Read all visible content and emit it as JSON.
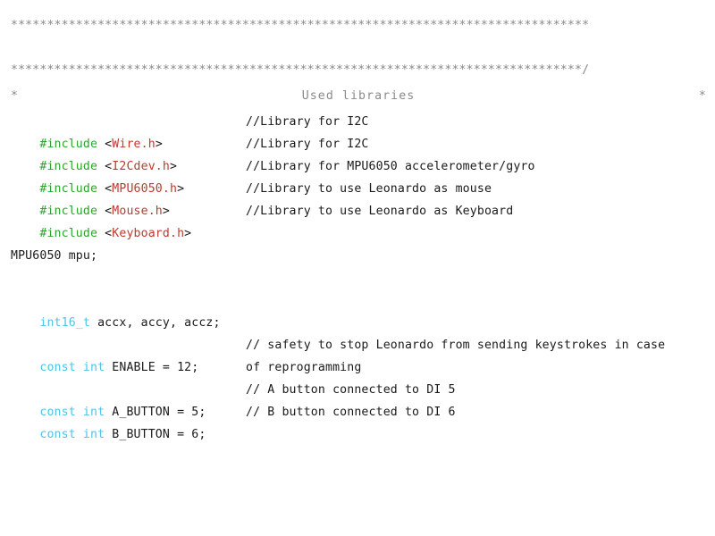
{
  "document": {
    "language": "arduino-c",
    "background_color": "#ffffff",
    "colors": {
      "preprocessor": "#2ea32e",
      "header_name": "#c0392b",
      "keyword": "#4fc3e8",
      "plain": "#1a1a1a",
      "comment": "#1a1a1a",
      "banner": "#8a8a8a"
    }
  },
  "banner": {
    "rule_top": "********************************************************************************",
    "left_star": "*",
    "title": "Used libraries",
    "right_star": "*",
    "rule_bottom": "*******************************************************************************/"
  },
  "includes": [
    {
      "directive": "#include",
      "open_angle": "<",
      "header": "Wire.h",
      "close_angle": ">",
      "comment": "//Library for I2C"
    },
    {
      "directive": "#include",
      "open_angle": "<",
      "header": "I2Cdev.h",
      "close_angle": ">",
      "comment": "//Library for I2C"
    },
    {
      "directive": "#include",
      "open_angle": "<",
      "header": "MPU6050.h",
      "close_angle": ">",
      "comment": "//Library for MPU6050 accelerometer/gyro"
    },
    {
      "directive": "#include",
      "open_angle": "<",
      "header": "Mouse.h",
      "close_angle": ">",
      "comment": "//Library to use Leonardo as mouse"
    },
    {
      "directive": "#include",
      "open_angle": "<",
      "header": "Keyboard.h",
      "close_angle": ">",
      "comment": "//Library to use Leonardo as Keyboard"
    }
  ],
  "declarations": {
    "object_decl": "MPU6050 mpu;",
    "accel_type": "int16_t",
    "accel_names": " accx, accy, accz;"
  },
  "constants": [
    {
      "keyword": "const int",
      "name": " ENABLE = 12;",
      "comment": "// safety to stop Leonardo from sending keystrokes in case",
      "comment_wrap": "of reprogramming"
    },
    {
      "keyword": "const int",
      "name": " A_BUTTON = 5;",
      "comment": "// A button connected to DI 5",
      "comment_wrap": ""
    },
    {
      "keyword": "const int",
      "name": " B_BUTTON = 6;",
      "comment": "// B button connected to DI 6",
      "comment_wrap": ""
    }
  ]
}
